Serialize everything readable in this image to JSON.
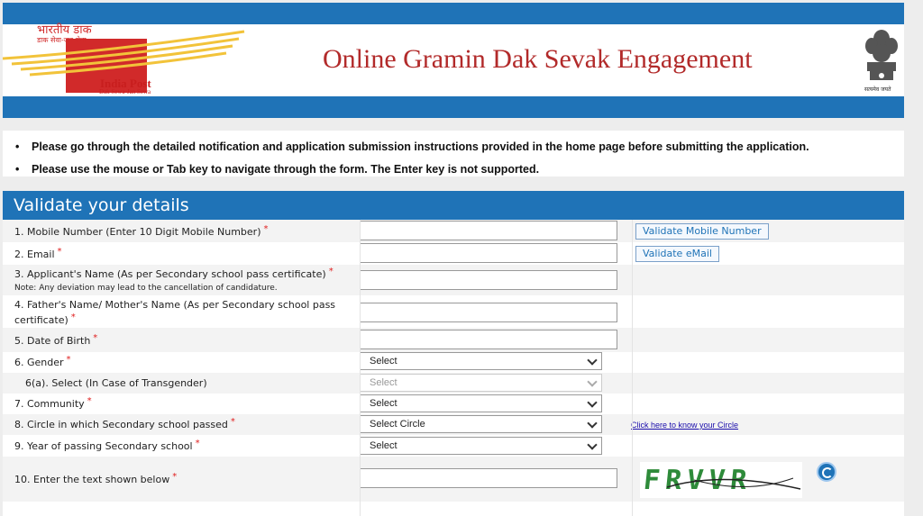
{
  "header": {
    "logo_hindi": "भारतीय डाक",
    "logo_hindi_sub": "डाक सेवा-जन सेवा",
    "logo_name": "India Post",
    "logo_tagline": "Dak Sewa-Jan Sewa",
    "title": "Online Gramin Dak Sevak Engagement",
    "emblem_caption": "सत्यमेव जयते"
  },
  "instructions": [
    "Please go through the detailed notification and application submission instructions provided in the home page before submitting the application.",
    "Please use the mouse or Tab key to navigate through the form. The Enter key is not supported."
  ],
  "form": {
    "heading": "Validate your details",
    "required_mark": "*",
    "fields": {
      "mobile": {
        "label": "1. Mobile Number (Enter 10 Digit Mobile Number)",
        "value": "",
        "button": "Validate Mobile Number"
      },
      "email": {
        "label": "2. Email",
        "value": "",
        "button": "Validate eMail"
      },
      "name": {
        "label": "3. Applicant's Name (As per Secondary school pass certificate)",
        "note": "Note: Any deviation may lead to the cancellation of candidature.",
        "value": ""
      },
      "parent": {
        "label_line1": "4. Father's Name/ Mother's Name (As per Secondary school pass",
        "label_line2": "certificate)",
        "value": ""
      },
      "dob": {
        "label": "5. Date of Birth",
        "value": ""
      },
      "gender": {
        "label": "6. Gender",
        "selected": "Select"
      },
      "transgender": {
        "label": "6(a). Select (In Case of Transgender)",
        "selected": "Select"
      },
      "community": {
        "label": "7. Community",
        "selected": "Select"
      },
      "circle": {
        "label": "8. Circle in which Secondary school passed",
        "selected": "Select Circle",
        "link": "Click here to know your Circle"
      },
      "year": {
        "label": "9. Year of passing Secondary school",
        "selected": "Select"
      },
      "captcha": {
        "label": "10. Enter the text shown below",
        "value": "",
        "captcha_text": "FRVVR"
      }
    }
  },
  "colors": {
    "band_blue": "#1f73b7",
    "title_red": "#b22a2a",
    "required_red": "#e02020",
    "captcha_green": "#2e8b3a"
  }
}
